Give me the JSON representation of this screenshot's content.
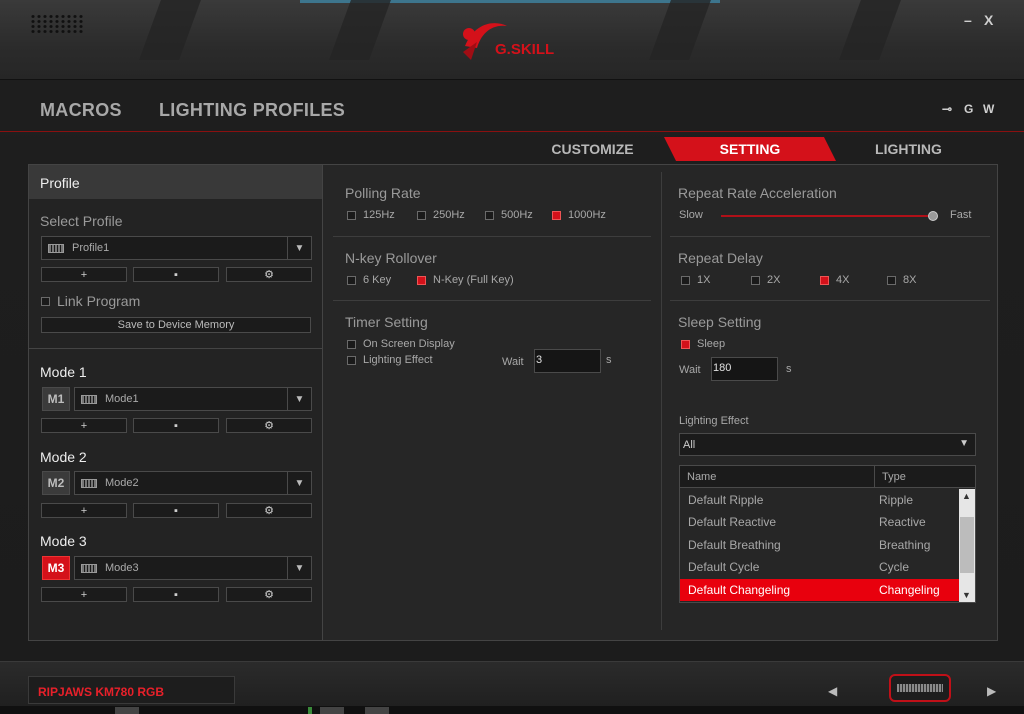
{
  "window": {
    "brand": "G.SKILL",
    "minimize_label": "–",
    "close_label": "X"
  },
  "nav": {
    "items": [
      "MACROS",
      "LIGHTING PROFILES"
    ],
    "icons": [
      "plug-icon",
      "G",
      "W"
    ]
  },
  "tabs": [
    {
      "label": "CUSTOMIZE",
      "active": false
    },
    {
      "label": "SETTING",
      "active": true
    },
    {
      "label": "LIGHTING",
      "active": false
    }
  ],
  "profile": {
    "header": "Profile",
    "select_label": "Select Profile",
    "selected": "Profile1",
    "buttons": [
      "+",
      "▪",
      "⚙"
    ],
    "link_program": "Link Program",
    "save_label": "Save to Device Memory"
  },
  "modes": [
    {
      "title": "Mode 1",
      "badge": "M1",
      "value": "Mode1",
      "active": false
    },
    {
      "title": "Mode 2",
      "badge": "M2",
      "value": "Mode2",
      "active": false
    },
    {
      "title": "Mode 3",
      "badge": "M3",
      "value": "Mode3",
      "active": true
    }
  ],
  "polling_rate": {
    "title": "Polling Rate",
    "options": [
      {
        "label": "125Hz",
        "checked": false
      },
      {
        "label": "250Hz",
        "checked": false
      },
      {
        "label": "500Hz",
        "checked": false
      },
      {
        "label": "1000Hz",
        "checked": true
      }
    ]
  },
  "nkey": {
    "title": "N-key Rollover",
    "options": [
      {
        "label": "6 Key",
        "checked": false
      },
      {
        "label": "N-Key (Full Key)",
        "checked": true
      }
    ]
  },
  "timer": {
    "title": "Timer Setting",
    "on_screen": "On Screen Display",
    "lighting_effect": "Lighting Effect",
    "wait_label": "Wait",
    "wait_value": "3",
    "unit": "s"
  },
  "repeat_rate": {
    "title": "Repeat Rate Acceleration",
    "slow": "Slow",
    "fast": "Fast",
    "value_fraction": 1.0
  },
  "repeat_delay": {
    "title": "Repeat Delay",
    "options": [
      {
        "label": "1X",
        "checked": false
      },
      {
        "label": "2X",
        "checked": false
      },
      {
        "label": "4X",
        "checked": true
      },
      {
        "label": "8X",
        "checked": false
      }
    ]
  },
  "sleep": {
    "title": "Sleep Setting",
    "sleep_label": "Sleep",
    "sleep_checked": true,
    "wait_label": "Wait",
    "wait_value": "180",
    "unit": "s",
    "lighting_effect_label": "Lighting Effect",
    "filter_value": "All",
    "columns": [
      "Name",
      "Type"
    ],
    "rows": [
      {
        "name": "Default Ripple",
        "type": "Ripple",
        "selected": false
      },
      {
        "name": "Default Reactive",
        "type": "Reactive",
        "selected": false
      },
      {
        "name": "Default Breathing",
        "type": "Breathing",
        "selected": false
      },
      {
        "name": "Default Cycle",
        "type": "Cycle",
        "selected": false
      },
      {
        "name": "Default Changeling",
        "type": "Changeling",
        "selected": true
      }
    ]
  },
  "footer": {
    "device": "RIPJAWS KM780 RGB",
    "prev": "◀",
    "next": "▶"
  },
  "colors": {
    "accent": "#d4111a",
    "selection": "#e8000d",
    "background": "#1e1e1e"
  }
}
